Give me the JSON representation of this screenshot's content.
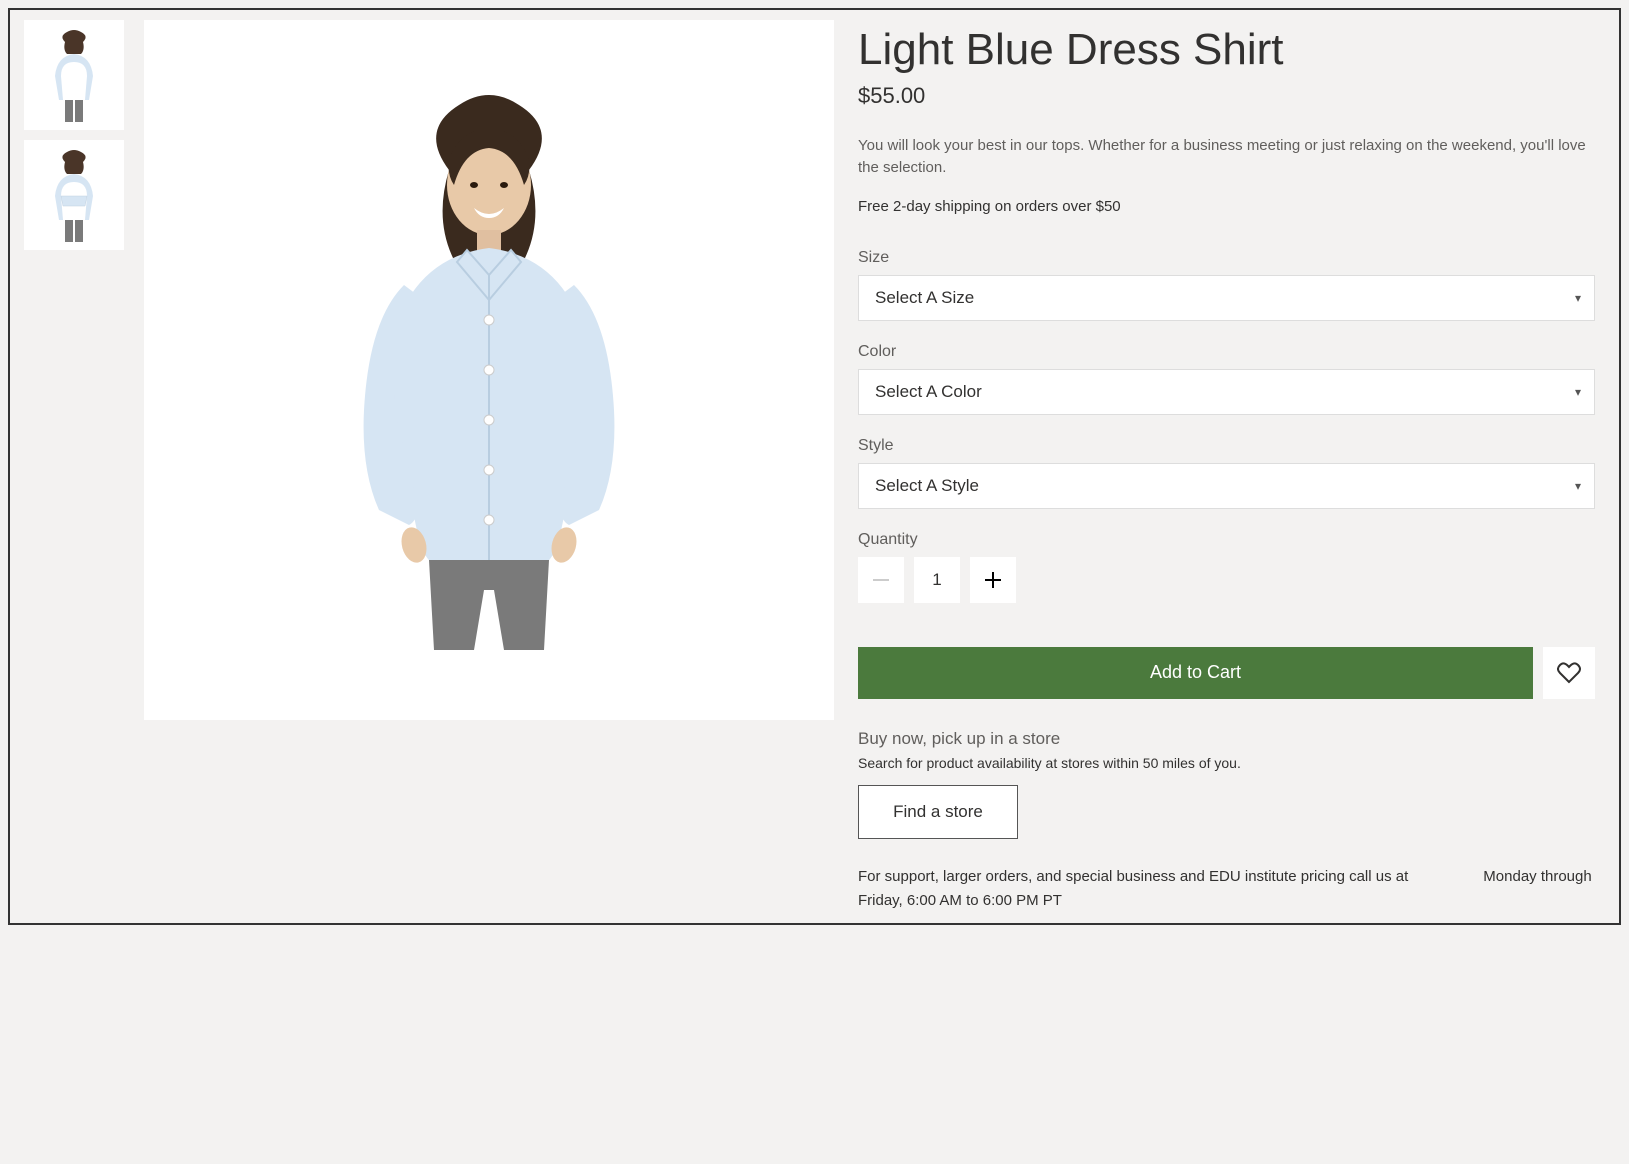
{
  "product": {
    "title": "Light Blue Dress Shirt",
    "price": "$55.00",
    "description": "You will look your best in our tops. Whether for a business meeting or just relaxing on the weekend, you'll love the selection.",
    "shipping_note": "Free 2-day shipping on orders over $50"
  },
  "options": {
    "size_label": "Size",
    "size_placeholder": "Select A Size",
    "color_label": "Color",
    "color_placeholder": "Select A Color",
    "style_label": "Style",
    "style_placeholder": "Select A Style"
  },
  "quantity": {
    "label": "Quantity",
    "value": "1"
  },
  "actions": {
    "add_to_cart": "Add to Cart"
  },
  "pickup": {
    "title": "Buy now, pick up in a store",
    "description": "Search for product availability at stores within 50 miles of you.",
    "button": "Find a store"
  },
  "support": {
    "line1": "For support, larger orders, and special business and EDU institute pricing call us at",
    "line2": "Monday through Friday, 6:00 AM to 6:00 PM PT"
  }
}
